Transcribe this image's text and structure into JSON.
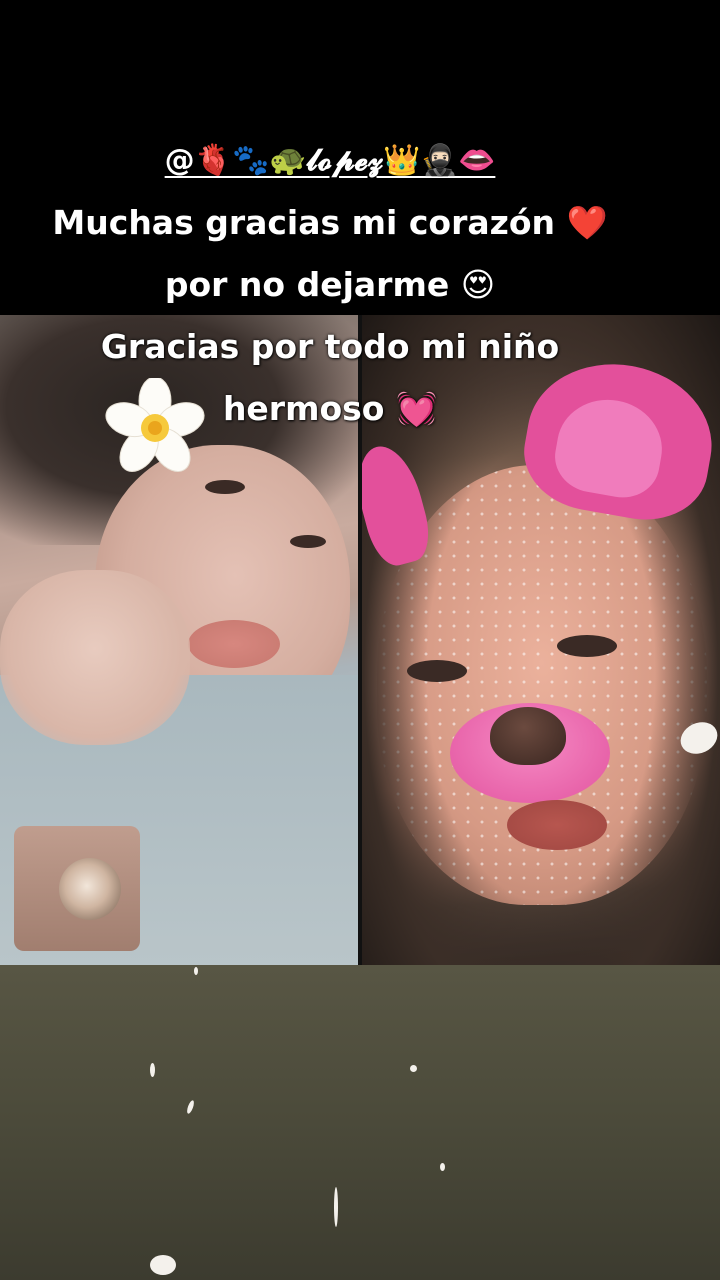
{
  "caption": {
    "mention": "@🫀🐾🐢𝓵𝓸𝓹𝓮𝔃👑🥷🏻👄",
    "line1": "Muchas gracias mi corazón ❤️",
    "line2": "por no dejarme 😍",
    "line3": "Gracias por todo mi niño",
    "line4": "hermoso 💓"
  },
  "colors": {
    "top_bar": "#000000",
    "bottom_area": "#4b4a3a",
    "filter_pink": "#e3509b",
    "caption_text": "#ffffff"
  },
  "icons": {
    "flower": "plumeria-flower-sticker",
    "effect": "dog-face-filter"
  }
}
